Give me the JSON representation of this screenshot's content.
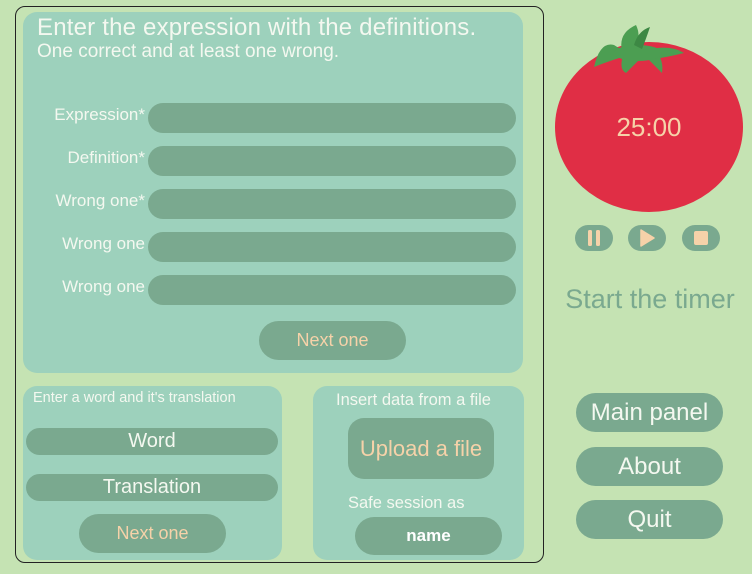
{
  "form": {
    "title": "Enter the expression with the definitions.",
    "subtitle": "One correct and at least one wrong.",
    "fields": [
      {
        "label": "Expression*",
        "value": ""
      },
      {
        "label": "Definition*",
        "value": ""
      },
      {
        "label": "Wrong one*",
        "value": ""
      },
      {
        "label": "Wrong one",
        "value": ""
      },
      {
        "label": "Wrong one",
        "value": ""
      }
    ],
    "next_label": "Next one"
  },
  "word_panel": {
    "heading": "Enter a word and it's translation",
    "word_placeholder": "Word",
    "translation_placeholder": "Translation",
    "next_label": "Next one"
  },
  "file_panel": {
    "heading": "Insert data from a file",
    "upload_label": "Upload a file",
    "save_label": "Safe session as",
    "name_value": "name"
  },
  "timer": {
    "time": "25:00",
    "status": "Start the timer",
    "controls": [
      "pause-icon",
      "play-icon",
      "stop-icon"
    ]
  },
  "nav": {
    "main_panel": "Main panel",
    "about": "About",
    "quit": "Quit"
  },
  "colors": {
    "background": "#c5e3b3",
    "panel": "#9dd1bc",
    "control": "#7aa98f",
    "accent_text": "#f6d2a9",
    "tomato": "#e02e45",
    "leaves": "#4c9e52"
  }
}
